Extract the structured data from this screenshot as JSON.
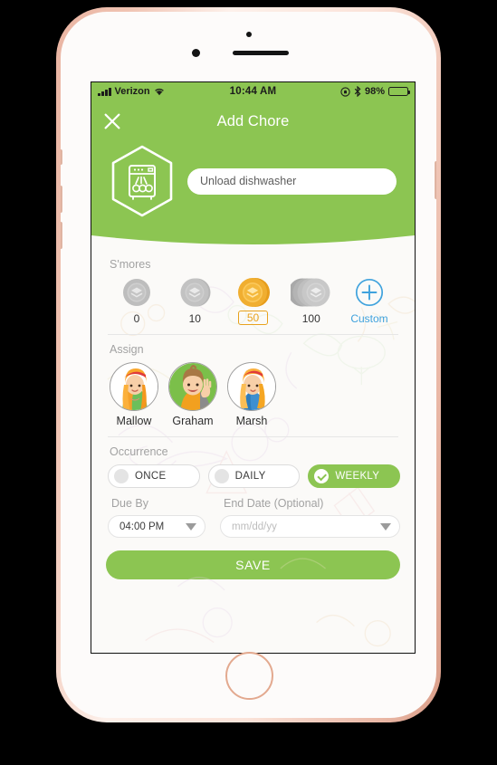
{
  "statusbar": {
    "carrier": "Verizon",
    "time": "10:44 AM",
    "battery_percent": "98%",
    "icons": [
      "signal-bars-icon",
      "wifi-icon",
      "rotation-lock-icon",
      "bluetooth-icon",
      "battery-icon"
    ]
  },
  "nav": {
    "title": "Add Chore",
    "close_icon": "close-x-icon"
  },
  "hero": {
    "chore_icon": "dishwasher-icon",
    "chore_name_value": "Unload dishwasher",
    "chore_name_placeholder": "Unload dishwasher"
  },
  "smores": {
    "label": "S'mores",
    "options": [
      {
        "value": "0",
        "selected": false,
        "style": "silver"
      },
      {
        "value": "10",
        "selected": false,
        "style": "silver"
      },
      {
        "value": "50",
        "selected": true,
        "style": "gold"
      },
      {
        "value": "100",
        "selected": false,
        "style": "silver-stack"
      }
    ],
    "custom": {
      "label": "Custom",
      "icon": "plus-circle-icon"
    }
  },
  "assign": {
    "label": "Assign",
    "people": [
      {
        "name": "Mallow",
        "avatar": "girl-orange-hair-avatar"
      },
      {
        "name": "Graham",
        "avatar": "boy-waving-avatar"
      },
      {
        "name": "Marsh",
        "avatar": "girl-blonde-blue-avatar"
      }
    ]
  },
  "occurrence": {
    "label": "Occurrence",
    "options": [
      {
        "label": "ONCE",
        "selected": false
      },
      {
        "label": "DAILY",
        "selected": false
      },
      {
        "label": "WEEKLY",
        "selected": true
      }
    ]
  },
  "schedule": {
    "due_by_label": "Due By",
    "due_by_value": "04:00 PM",
    "end_date_label": "End Date (Optional)",
    "end_date_placeholder": "mm/dd/yy"
  },
  "actions": {
    "save_label": "SAVE"
  },
  "colors": {
    "brand_green": "#8cc552",
    "gold": "#e8a21d",
    "blue": "#3fa2dd",
    "bezel": "#e9b4a2"
  }
}
